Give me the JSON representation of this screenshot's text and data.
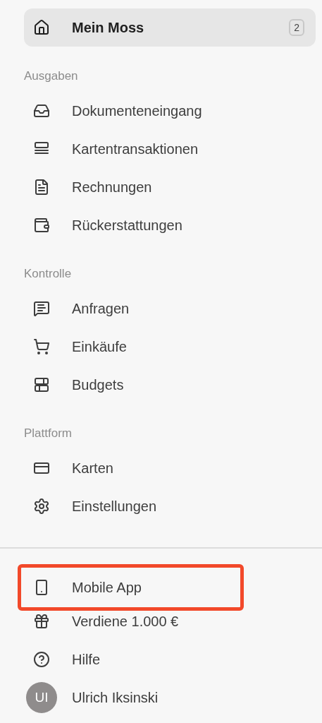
{
  "home": {
    "label": "Mein Moss",
    "badge": "2",
    "selected": true
  },
  "sections": [
    {
      "heading": "Ausgaben",
      "items": [
        {
          "label": "Dokumenteneingang"
        },
        {
          "label": "Kartentransaktionen"
        },
        {
          "label": "Rechnungen"
        },
        {
          "label": "Rückerstattungen"
        }
      ]
    },
    {
      "heading": "Kontrolle",
      "items": [
        {
          "label": "Anfragen"
        },
        {
          "label": "Einkäufe"
        },
        {
          "label": "Budgets"
        }
      ]
    },
    {
      "heading": "Plattform",
      "items": [
        {
          "label": "Karten"
        },
        {
          "label": "Einstellungen"
        }
      ]
    }
  ],
  "footer": [
    {
      "kind": "link",
      "label": "Mobile App",
      "highlighted": true
    },
    {
      "kind": "link",
      "label": "Verdiene 1.000 €",
      "highlighted": false
    },
    {
      "kind": "link",
      "label": "Hilfe",
      "highlighted": false
    },
    {
      "kind": "user",
      "label": "Ulrich Iksinski",
      "avatar": "UI",
      "highlighted": false
    }
  ]
}
